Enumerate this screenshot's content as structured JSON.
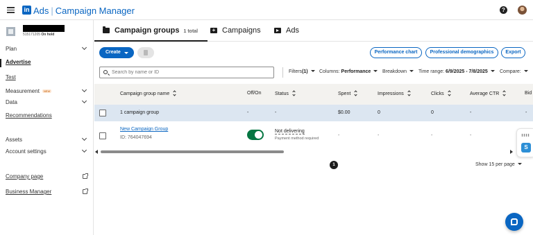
{
  "app": {
    "logo_text": "in",
    "brand_ads": "Ads",
    "brand_separator": "|",
    "brand_product": "Campaign Manager",
    "help_symbol": "?"
  },
  "account": {
    "id_text": "515171205",
    "status": "On hold"
  },
  "sidebar": {
    "items": [
      {
        "label": "Plan"
      },
      {
        "label": "Advertise"
      },
      {
        "label": "Test"
      },
      {
        "label": "Measurement",
        "badge": "NEW"
      },
      {
        "label": "Data"
      },
      {
        "label": "Recommendations"
      },
      {
        "label": "Assets"
      },
      {
        "label": "Account settings"
      },
      {
        "label": "Company page"
      },
      {
        "label": "Business Manager"
      }
    ]
  },
  "tabs": [
    {
      "label": "Campaign groups",
      "sub": "1 total",
      "icon": "folder-icon"
    },
    {
      "label": "Campaigns",
      "icon": "campaign-icon"
    },
    {
      "label": "Ads",
      "icon": "ad-icon"
    }
  ],
  "toolbar": {
    "create_label": "Create",
    "performance_chart": "Performance chart",
    "professional_demographics": "Professional demographics",
    "export": "Export"
  },
  "search": {
    "placeholder": "Search by name or ID"
  },
  "filters": {
    "filters_label": "Filters",
    "filters_count": "(1)",
    "columns_label": "Columns:",
    "columns_value": "Performance",
    "breakdown_label": "Breakdown",
    "time_range_label": "Time range:",
    "time_range_value": "6/9/2025 - 7/8/2025",
    "compare_label": "Compare:"
  },
  "table": {
    "headers": [
      "Campaign group name",
      "Off/On",
      "Status",
      "Spent",
      "Impressions",
      "Clicks",
      "Average CTR",
      "Bid"
    ],
    "summary": {
      "name": "1 campaign group",
      "offon": "-",
      "status": "-",
      "spent": "$0.00",
      "impressions": "0",
      "clicks": "0",
      "ctr": "-",
      "bid": "-"
    },
    "rows": [
      {
        "name": "New Campaign Group",
        "id_line": "ID: 764047694",
        "toggle_on": true,
        "status": "Not delivering",
        "status_detail": "Payment method required",
        "spent": "-",
        "impressions": "-",
        "clicks": "-",
        "ctr": "-",
        "bid": "-"
      }
    ]
  },
  "pagination": {
    "current_page": "1",
    "per_page": "Show 15 per page"
  },
  "colors": {
    "accent": "#0a66c2",
    "toggle_on": "#057642",
    "summary_row": "#dce6f1"
  }
}
